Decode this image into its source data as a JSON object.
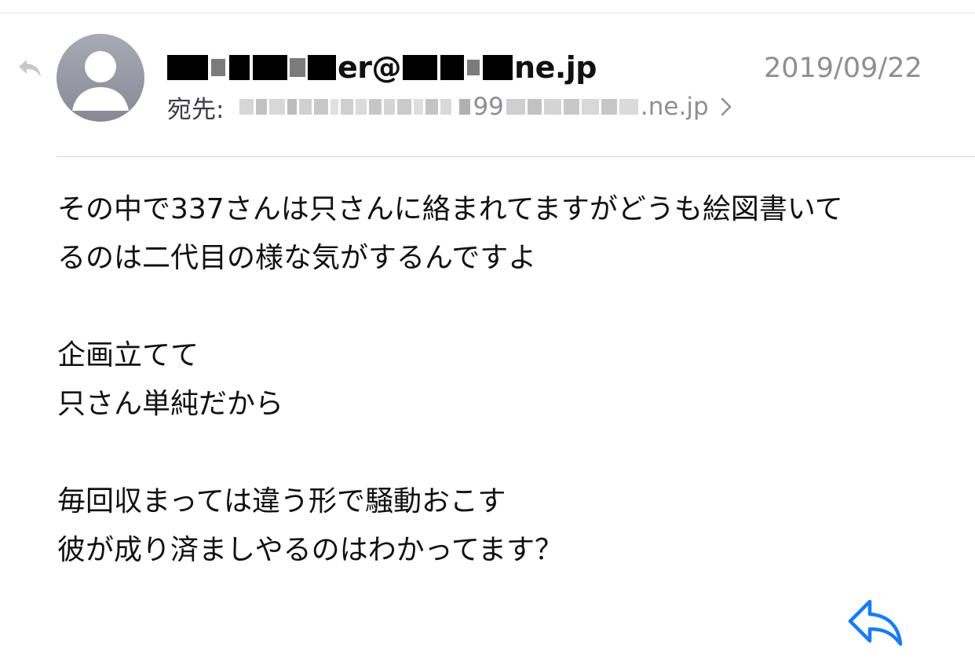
{
  "email": {
    "sender": {
      "address_suffix_1": "er@",
      "address_suffix_2": "ne.jp",
      "avatar_icon": "person-icon"
    },
    "date": "2019/09/22",
    "recipient": {
      "label": "宛先:",
      "visible_part_1": "99",
      "visible_part_2": ".ne.jp"
    },
    "body": {
      "lines": [
        "その中で337さんは只さんに絡まれてますがどうも絵図書いて",
        "るのは二代目の様な気がするんですよ",
        "",
        "企画立てて",
        "只さん単純だから",
        "",
        "毎回収まっては違う形で騒動おこす",
        "彼が成り済ましやるのはわかってます？"
      ]
    },
    "actions": {
      "reply_icon": "reply-icon",
      "back_icon": "back-arrow-icon"
    }
  },
  "colors": {
    "accent": "#1a7cf5",
    "secondary_text": "#8e8e93",
    "avatar": "#9a9ca5"
  }
}
